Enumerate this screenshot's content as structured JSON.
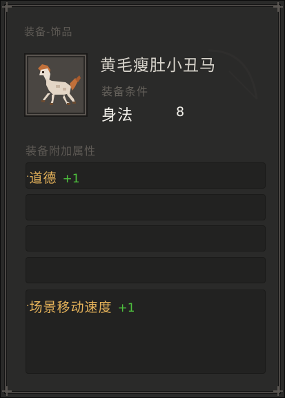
{
  "tooltip": {
    "category": "装备-饰品",
    "item_name": "黄毛瘦肚小丑马",
    "item_icon": "horse-icon",
    "requirement_label": "装备条件",
    "requirement": {
      "stat": "身法",
      "value": "8"
    },
    "attributes_header": "装备附加属性",
    "attribute_slots": [
      {
        "bullet": "·",
        "name": "道德",
        "bonus": "+1"
      },
      {
        "bullet": "",
        "name": "",
        "bonus": ""
      },
      {
        "bullet": "",
        "name": "",
        "bonus": ""
      },
      {
        "bullet": "",
        "name": "",
        "bonus": ""
      },
      {
        "bullet": "·",
        "name": "场景移动速度",
        "bonus": "+1"
      }
    ]
  },
  "colors": {
    "panel_bg": "#2a2a29",
    "name_text": "#d8d4cc",
    "dim_text": "#5e5a55",
    "attribute_gold": "#e6b35a",
    "bonus_green": "#4dbf3d"
  }
}
